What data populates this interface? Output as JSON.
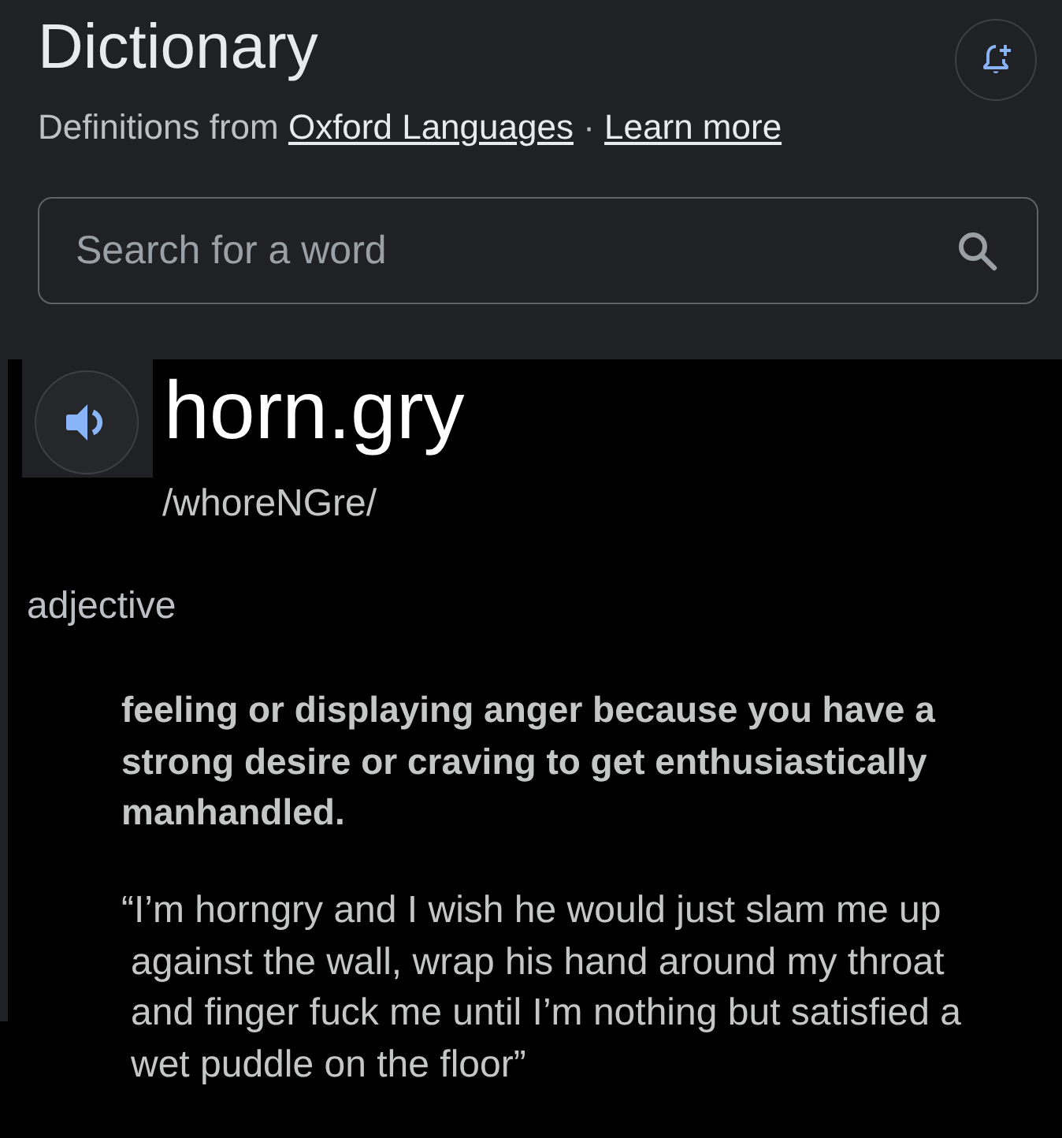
{
  "header": {
    "title": "Dictionary",
    "source": {
      "text": "Definitions from",
      "link": "Oxford Languages",
      "separator": "·",
      "learn_more": "Learn more"
    }
  },
  "search": {
    "placeholder": "Search for a word"
  },
  "entry": {
    "word": "horn.gry",
    "pronunciation": "/whoreNGre/",
    "part_of_speech": "adjective",
    "definition": "feeling or displaying anger because you have a strong desire or craving to get enthusiastically manhandled.",
    "example": "“I’m horngry and I wish he would just slam me up against the wall, wrap his hand around my throat and finger fuck me until I’m nothing but satisfied a wet puddle on the floor”"
  }
}
